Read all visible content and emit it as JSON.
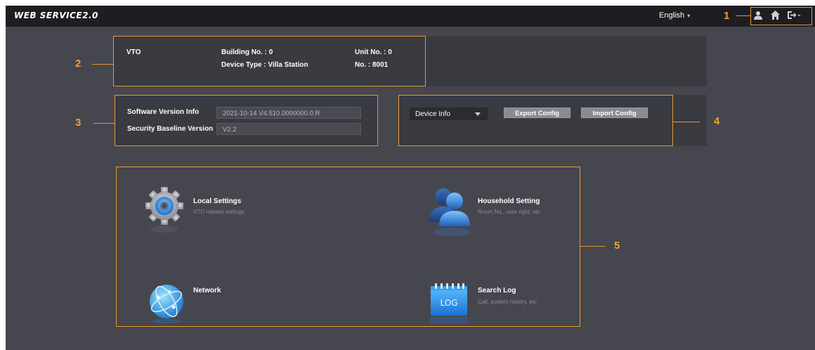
{
  "app": {
    "logo": "WEB SERVICE2.0"
  },
  "topbar": {
    "language": "English",
    "icons": [
      "user-icon",
      "home-icon",
      "logout-icon"
    ]
  },
  "device": {
    "name": "VTO",
    "building_label": "Building No. : 0",
    "unit_label": "Unit No. : 0",
    "device_type_label": "Device Type : Villa Station",
    "no_label": "No. : 8001"
  },
  "version": {
    "software_label": "Software Version Info",
    "software_value": "2021-10-14 V4.510.0000000.0.R",
    "baseline_label": "Security Baseline Version",
    "baseline_value": "V2.2"
  },
  "config": {
    "selected": "Device Info",
    "export_label": "Export Config",
    "import_label": "Import Config"
  },
  "tiles": [
    {
      "title": "Local Settings",
      "subtitle": "VTO related settings",
      "icon": "gear-icon"
    },
    {
      "title": "Household Setting",
      "subtitle": "Room No., user right, etc",
      "icon": "users-icon"
    },
    {
      "title": "Network",
      "subtitle": "",
      "icon": "globe-icon"
    },
    {
      "title": "Search Log",
      "subtitle": "Call, system history, etc",
      "icon": "log-icon",
      "icon_text": "LOG"
    }
  ],
  "callouts": [
    "1",
    "2",
    "3",
    "4",
    "5"
  ],
  "colors": {
    "accent": "#e69a2e",
    "topbar": "#1e1e22",
    "background": "#46464f",
    "panel": "#3a3a41"
  }
}
